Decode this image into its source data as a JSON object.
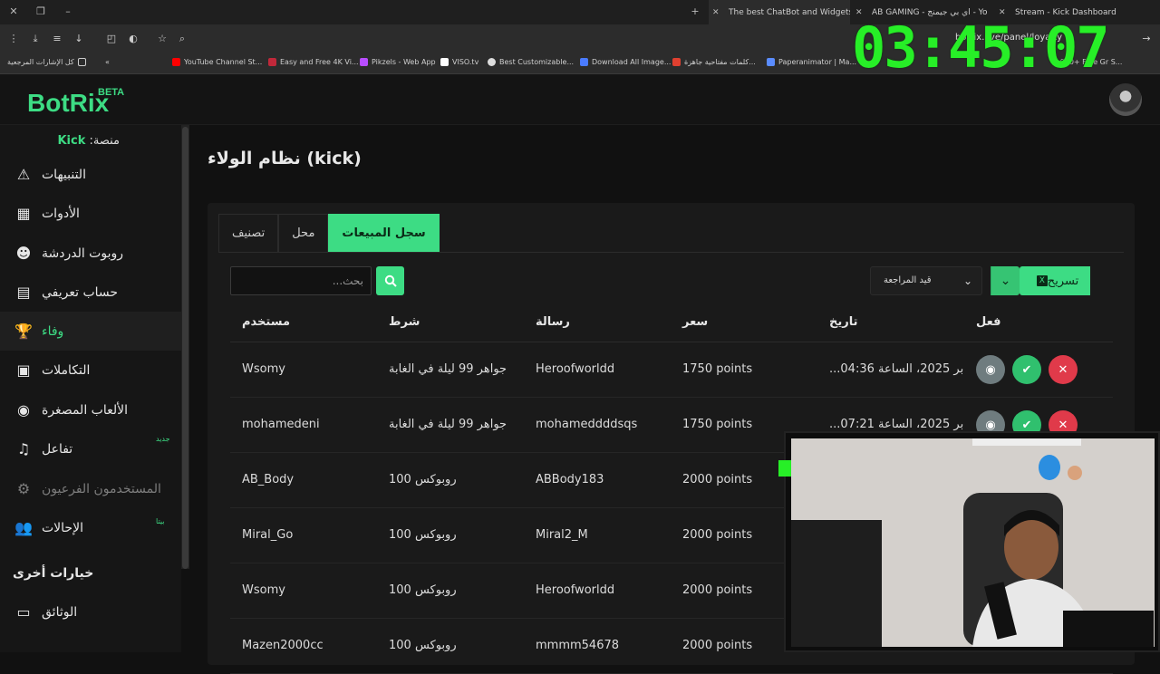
{
  "browser": {
    "tabs": [
      {
        "title": "The best ChatBot and Widgets",
        "active": true,
        "fav_color": "#ffffff"
      },
      {
        "title": "AB GAMING - اي بي جيمنج - Yo",
        "active": false,
        "fav_color": "#ff0000"
      },
      {
        "title": "Stream - Kick Dashboard",
        "active": false,
        "fav_color": "#53fc18"
      }
    ],
    "url": "botrix.live/panel/loyalty",
    "bookmarks": [
      "كل الإشارات المرجعية",
      "YouTube Channel St...",
      "Easy and Free 4K Vi...",
      "Pikzels - Web App",
      "VISO.tv",
      "Best Customizable...",
      "Download All Image...",
      "كلمات مفتاحية جاهزة...",
      "Paperanimator | Ma...",
      "7,000+ Free Gr S..."
    ]
  },
  "overlay": {
    "clock": "03:45:07"
  },
  "app": {
    "logo": "BotRix",
    "beta": "BETA",
    "platform_label": "منصة:",
    "platform_value": "Kick"
  },
  "sidebar": {
    "items": [
      {
        "label": "التنبيهات",
        "icon": "warning-icon"
      },
      {
        "label": "الأدوات",
        "icon": "grid-icon"
      },
      {
        "label": "روبوت الدردشة",
        "icon": "robot-icon"
      },
      {
        "label": "حساب تعريفي",
        "icon": "id-card-icon"
      },
      {
        "label": "وفاء",
        "icon": "trophy-icon"
      },
      {
        "label": "التكاملات",
        "icon": "integrations-icon"
      },
      {
        "label": "الألعاب المصغرة",
        "icon": "gamepad-icon"
      },
      {
        "label": "تفاعل",
        "icon": "music-icon",
        "badge": "جديد"
      },
      {
        "label": "المستخدمون الفرعيون",
        "icon": "settings-icon"
      },
      {
        "label": "الإحالات",
        "icon": "users-icon",
        "badge": "بيتا"
      },
      {
        "label": "الوثائق",
        "icon": "docs-icon"
      }
    ],
    "section_title": "خيارات أخرى"
  },
  "main": {
    "title": "نظام الولاء (kick)",
    "tabs": [
      "تصنيف",
      "محل",
      "سجل المبيعات"
    ],
    "search_placeholder": "بحث...",
    "status_select": "قيد المراجعة",
    "export_label": "تسريح",
    "export_icon": "X",
    "columns": {
      "user": "مستخدم",
      "condition": "شرط",
      "message": "رسالة",
      "price": "سعر",
      "date": "تاريخ",
      "action": "فعل"
    },
    "rows": [
      {
        "user": "Wsomy",
        "condition": "جواهر 99 ليلة في الغابة",
        "message": "Heroofworldd",
        "price": "1750 points",
        "date": "...بر 2025، الساعة 04:36"
      },
      {
        "user": "mohamedeni",
        "condition": "جواهر 99 ليلة في الغابة",
        "message": "mohameddddsqs",
        "price": "1750 points",
        "date": "...بر 2025، الساعة 07:21"
      },
      {
        "user": "AB_Body",
        "condition": "روبوكس 100",
        "message": "ABBody183",
        "price": "2000 points",
        "date": ""
      },
      {
        "user": "Miral_Go",
        "condition": "روبوكس 100",
        "message": "Miral2_M",
        "price": "2000 points",
        "date": ""
      },
      {
        "user": "Wsomy",
        "condition": "روبوكس 100",
        "message": "Heroofworldd",
        "price": "2000 points",
        "date": ""
      },
      {
        "user": "Mazen2000cc",
        "condition": "روبوكس 100",
        "message": "mmmm54678",
        "price": "2000 points",
        "date": ""
      }
    ]
  },
  "colors": {
    "accent": "#3ddc84",
    "danger": "#e03a4a",
    "clock": "#27ef27"
  }
}
